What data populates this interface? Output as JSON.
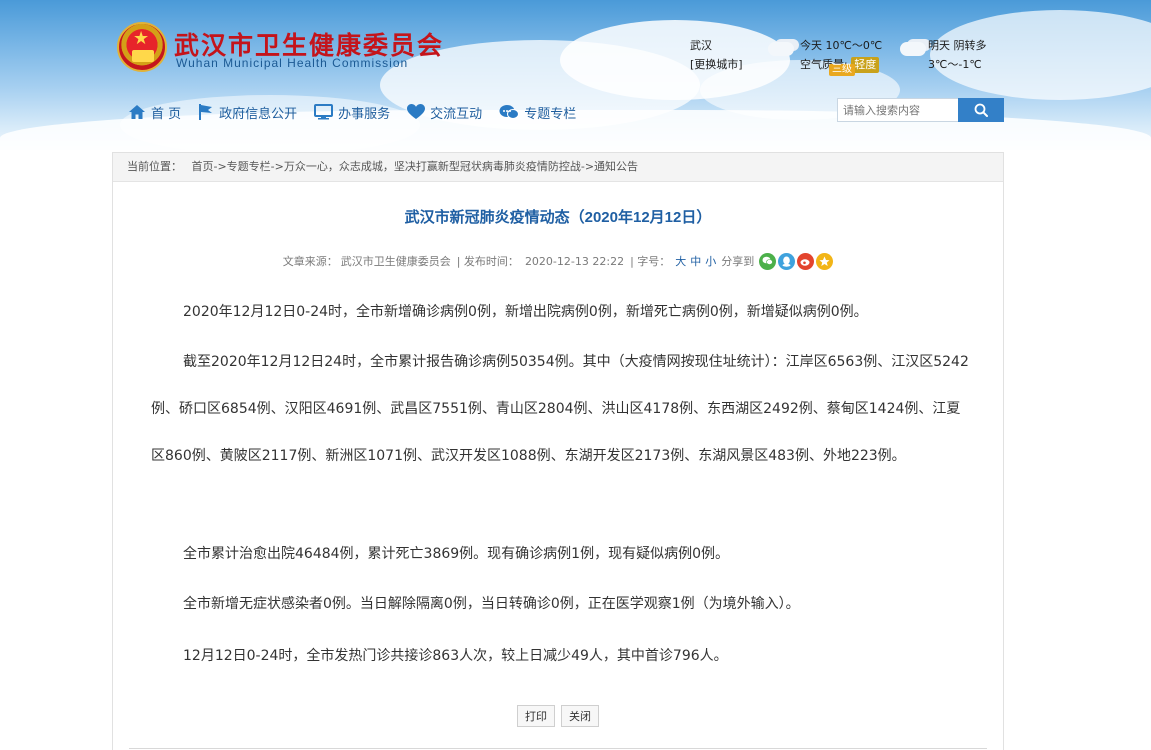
{
  "site": {
    "title": "武汉市卫生健康委员会",
    "subtitle": "Wuhan Municipal Health Commission"
  },
  "weather": {
    "city": "武汉",
    "change_city": "[更换城市]",
    "today": "今天",
    "today_temp": "10℃～0℃",
    "air_quality_label": "空气质量:",
    "air_quality_value": "轻度",
    "air_quality_sub": "三级",
    "tomorrow": "明天",
    "tomorrow_condition": "阴转多",
    "tomorrow_temp": "3℃～-1℃"
  },
  "nav": {
    "items": [
      {
        "label": "首 页",
        "icon": "home-icon"
      },
      {
        "label": "政府信息公开",
        "icon": "flag-icon"
      },
      {
        "label": "办事服务",
        "icon": "monitor-icon"
      },
      {
        "label": "交流互动",
        "icon": "heart-icon"
      },
      {
        "label": "专题专栏",
        "icon": "chat-icon"
      }
    ]
  },
  "search": {
    "placeholder": "请输入搜索内容"
  },
  "breadcrumb": {
    "label": "当前位置：",
    "path": "首页->专题专栏->万众一心，众志成城，坚决打赢新型冠状病毒肺炎疫情防控战->通知公告"
  },
  "article": {
    "title": "武汉市新冠肺炎疫情动态（2020年12月12日）",
    "source_label": "文章来源：",
    "source": "武汉市卫生健康委员会",
    "publish_label": "| 发布时间：",
    "publish_time": "2020-12-13 22:22",
    "font_label": "| 字号：",
    "font_large": "大",
    "font_medium": "中",
    "font_small": "小",
    "share_label": "分享到",
    "paragraphs": [
      "2020年12月12日0-24时，全市新增确诊病例0例，新增出院病例0例，新增死亡病例0例，新增疑似病例0例。",
      "截至2020年12月12日24时，全市累计报告确诊病例50354例。其中（大疫情网按现住址统计）：江岸区6563例、江汉区5242例、硚口区6854例、汉阳区4691例、武昌区7551例、青山区2804例、洪山区4178例、东西湖区2492例、蔡甸区1424例、江夏区860例、黄陂区2117例、新洲区1071例、武汉开发区1088例、东湖开发区2173例、东湖风景区483例、外地223例。",
      "全市累计治愈出院46484例，累计死亡3869例。现有确诊病例1例，现有疑似病例0例。",
      "全市新增无症状感染者0例。当日解除隔离0例，当日转确诊0例，正在医学观察1例（为境外输入）。",
      "12月12日0-24时，全市发热门诊共接诊863人次，较上日减少49人，其中首诊796人。"
    ]
  },
  "buttons": {
    "print": "打印",
    "close": "关闭"
  },
  "colors": {
    "brand_red": "#c4141b",
    "brand_blue": "#1f5fa3",
    "search_button": "#3380c8"
  }
}
